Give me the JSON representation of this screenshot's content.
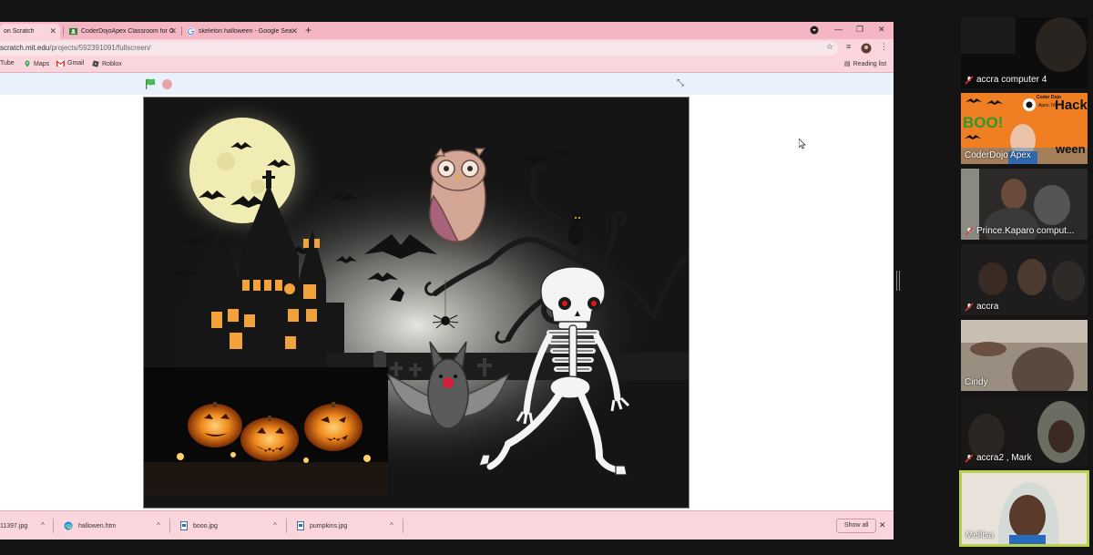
{
  "browser": {
    "tabs": [
      {
        "title": "on Scratch",
        "active": true
      },
      {
        "title": "CoderDojoApex Classroom for C",
        "active": false
      },
      {
        "title": "skeleton halloween - Google Sea",
        "active": false
      }
    ],
    "new_tab_label": "+",
    "url_host": "scratch.mit.edu",
    "url_path": "/projects/592391091/fullscreen/",
    "bookmarks": [
      {
        "label": "Tube",
        "icon": "youtube-icon"
      },
      {
        "label": "Maps",
        "icon": "maps-icon"
      },
      {
        "label": "Gmail",
        "icon": "gmail-icon"
      },
      {
        "label": "Roblox",
        "icon": "roblox-icon"
      }
    ],
    "reading_list_label": "Reading list"
  },
  "scratch": {
    "green_flag_icon": "green-flag-icon",
    "stop_icon": "stop-icon",
    "exit_fullscreen_icon": "exit-fullscreen-icon"
  },
  "downloads": {
    "items": [
      {
        "name": "11397.jpg",
        "type": "image"
      },
      {
        "name": "hallowen.htm",
        "type": "html"
      },
      {
        "name": "booo.jpg",
        "type": "image"
      },
      {
        "name": "pumpkins.jpg",
        "type": "image"
      }
    ],
    "show_all_label": "Show all"
  },
  "participants": [
    {
      "name": "accra computer 4",
      "muted": true
    },
    {
      "name": "CoderDojo Apex",
      "muted": false
    },
    {
      "name": "Prince.Kaparo comput...",
      "muted": true
    },
    {
      "name": "accra",
      "muted": true
    },
    {
      "name": "Cindy",
      "muted": false
    },
    {
      "name": "accra2 , Mark",
      "muted": true
    },
    {
      "name": "Mellisa",
      "muted": false
    }
  ],
  "coderdojo_tile": {
    "brand_line1": "Coder Dojo",
    "brand_line2": "Apex, NC",
    "word_hack": "Hack",
    "word_boo": "BOO!",
    "word_ween": "ween"
  },
  "colors": {
    "tab_strip": "#f4b6c2",
    "toolbar": "#fbd5dc",
    "stage_bar": "#e9f1fc",
    "active_speaker": "#b7d24a"
  }
}
